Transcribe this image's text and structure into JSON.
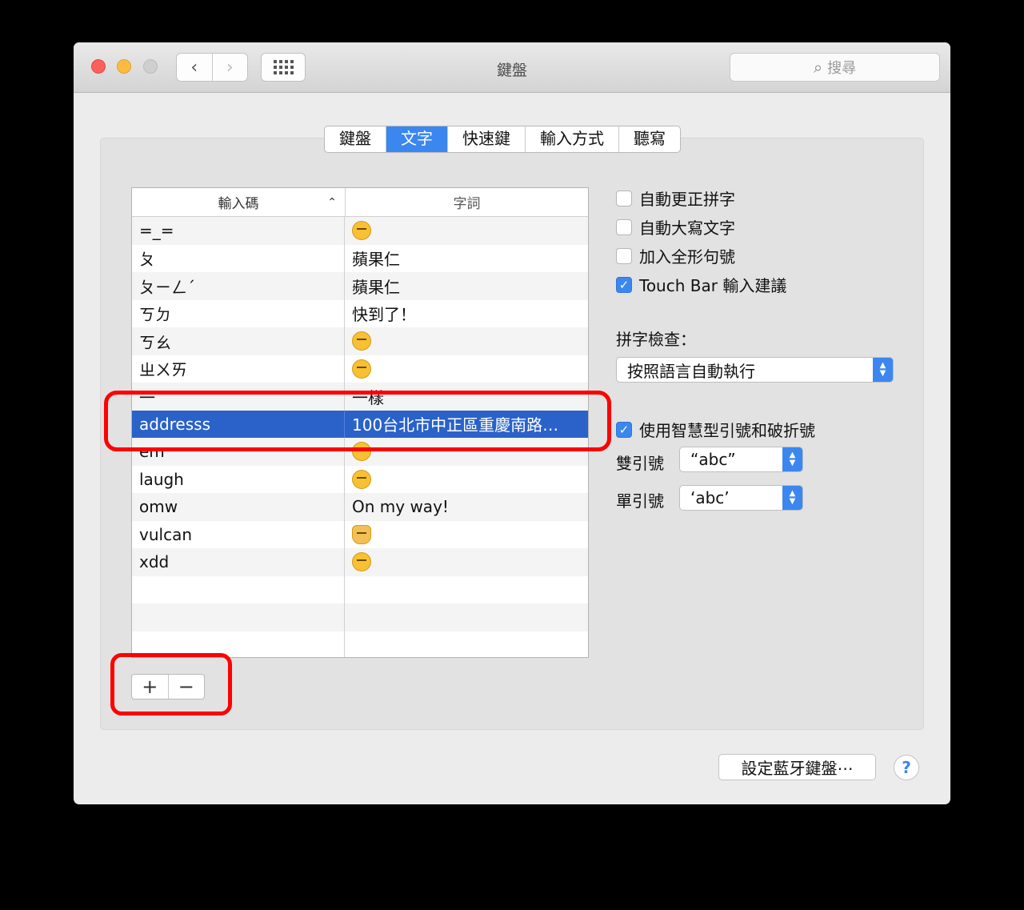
{
  "window": {
    "title": "鍵盤",
    "search_placeholder": "搜尋"
  },
  "tabs": [
    {
      "label": "鍵盤",
      "active": false
    },
    {
      "label": "文字",
      "active": true
    },
    {
      "label": "快速鍵",
      "active": false
    },
    {
      "label": "輸入方式",
      "active": false
    },
    {
      "label": "聽寫",
      "active": false
    }
  ],
  "table": {
    "col_replace": "輸入碼",
    "col_with": "字詞",
    "rows": [
      {
        "replace": "=_=",
        "with": "",
        "emoji": "expressionless-face"
      },
      {
        "replace": "ㄆ",
        "with": "蘋果仁"
      },
      {
        "replace": "ㄆㄧㄥˊ",
        "with": "蘋果仁"
      },
      {
        "replace": "ㄎㄉ",
        "with": "快到了！"
      },
      {
        "replace": "ㄎㄠ",
        "with": "",
        "emoji": "thinking-face"
      },
      {
        "replace": "ㄓㄨㄞ",
        "with": "",
        "emoji": "smirking-face"
      },
      {
        "replace": "一",
        "with": "一樣"
      },
      {
        "replace": "addresss",
        "with": "100台北市中正區重慶南路…",
        "selected": true
      },
      {
        "replace": "em",
        "with": "",
        "emoji": "eyes"
      },
      {
        "replace": "laugh",
        "with": "",
        "emoji": "tears-of-joy-face"
      },
      {
        "replace": "omw",
        "with": "On my way!"
      },
      {
        "replace": "vulcan",
        "with": "",
        "emoji": "vulcan-salute"
      },
      {
        "replace": "xdd",
        "with": "",
        "emoji": "grinning-squinting-face"
      },
      {
        "replace": "",
        "with": ""
      },
      {
        "replace": "",
        "with": ""
      },
      {
        "replace": "",
        "with": ""
      }
    ]
  },
  "buttons": {
    "add": "+",
    "remove": "−",
    "bluetooth": "設定藍牙鍵盤⋯",
    "help": "?"
  },
  "options": {
    "auto_correct": {
      "label": "自動更正拼字",
      "checked": false
    },
    "auto_capitalize": {
      "label": "自動大寫文字",
      "checked": false
    },
    "fullwidth_period": {
      "label": "加入全形句號",
      "checked": false
    },
    "touchbar": {
      "label": "Touch Bar 輸入建議",
      "checked": true
    },
    "spelling_label": "拼字檢查：",
    "spelling_value": "按照語言自動執行",
    "smart_quotes": {
      "label": "使用智慧型引號和破折號",
      "checked": true
    },
    "double_label": "雙引號",
    "double_value": "“abc”",
    "single_label": "單引號",
    "single_value": "‘abc’"
  },
  "colors": {
    "accent": "#3b87ef",
    "selection": "#2a62c9",
    "highlight": "#ff0000"
  }
}
